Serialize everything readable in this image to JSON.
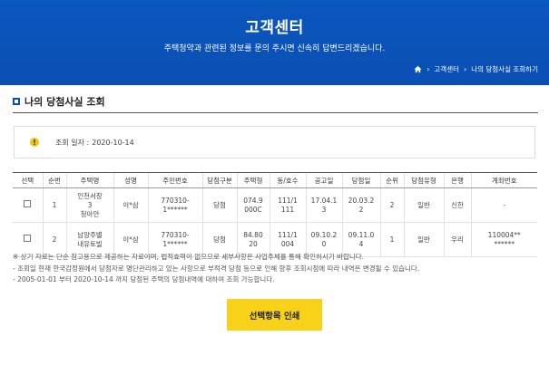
{
  "banner": {
    "title": "고객센터",
    "subtitle": "주택청약과 관련된 정보를 문의 주시면 신속히 답변드리겠습니다.",
    "breadcrumb": [
      "고객센터",
      "나의 당첨사실 조회하기"
    ]
  },
  "section": {
    "title": "나의 당첨사실 조회"
  },
  "notice": {
    "label": "조회 일자 :",
    "date": "2020-10-14"
  },
  "table": {
    "headers": [
      "선택",
      "순번",
      "주택명",
      "성명",
      "주민번호",
      "당첨구분",
      "주택형",
      "동/호수",
      "공고일",
      "당첨일",
      "순위",
      "당첨유형",
      "은행",
      "계좌번호"
    ],
    "rows": [
      [
        "",
        "1",
        "인천서창\n3\n청아안",
        "이*삼",
        "770310-\n1******",
        "당첨",
        "074.9\n000C",
        "111/1\n111",
        "17.04.1\n3",
        "20.03.2\n2",
        "2",
        "일반",
        "신한",
        "-"
      ],
      [
        "",
        "2",
        "남양주별\n내유토빌",
        "이*삼",
        "770310-\n1******",
        "당첨",
        "84.80\n20",
        "111/1\n004",
        "09.10.2\n0",
        "09.11.0\n4",
        "1",
        "일반",
        "우리",
        "110004**\n******"
      ]
    ]
  },
  "footnotes": [
    "※ 상기 자료는 단순 참고용으로 제공하는 자료이며, 법적효력이 없으므로 세부사항은 사업주체를 통해 확인하시기 바랍니다.",
    "- 조회일 현재 한국감정원에서 당첨자로 명단관리하고 있는 사항으로 부적격 당첨 등으로 인해 향후 조회시점에 따라 내역은 변경될 수 있습니다.",
    "- 2005-01-01 부터 2020-10-14 까지 당첨된 주택의 당첨내역에 대하여 조회 가능합니다."
  ],
  "actions": {
    "print_label": "선택항목 인쇄"
  },
  "colors": {
    "banner": "#0b4fb2",
    "button": "#f7d219",
    "warning": "#f2c318"
  }
}
